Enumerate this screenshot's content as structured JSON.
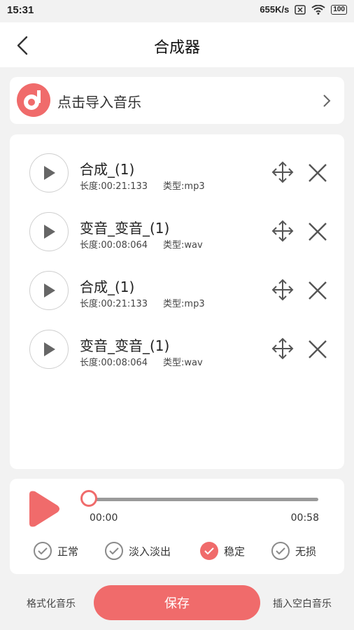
{
  "status_bar": {
    "time": "15:31",
    "speed": "655K/s",
    "battery": "100"
  },
  "header": {
    "title": "合成器",
    "back_icon": "back-arrow-icon"
  },
  "import": {
    "label": "点击导入音乐",
    "icon": "music-note-icon",
    "chevron": "chevron-right-icon"
  },
  "tracks": [
    {
      "name": "合成_(1)",
      "duration": "长度:00:21:133",
      "type": "类型:mp3"
    },
    {
      "name": "变音_变音_(1)",
      "duration": "长度:00:08:064",
      "type": "类型:wav"
    },
    {
      "name": "合成_(1)",
      "duration": "长度:00:21:133",
      "type": "类型:mp3"
    },
    {
      "name": "变音_变音_(1)",
      "duration": "长度:00:08:064",
      "type": "类型:wav"
    }
  ],
  "player": {
    "current": "00:00",
    "total": "00:58",
    "progress": 0
  },
  "options": [
    {
      "label": "正常",
      "checked": false
    },
    {
      "label": "淡入淡出",
      "checked": false
    },
    {
      "label": "稳定",
      "checked": true
    },
    {
      "label": "无损",
      "checked": false
    }
  ],
  "footer": {
    "format_label": "格式化音乐",
    "save_label": "保存",
    "insert_label": "插入空白音乐"
  },
  "colors": {
    "accent": "#f06b6b",
    "background": "#f2f2f2"
  }
}
